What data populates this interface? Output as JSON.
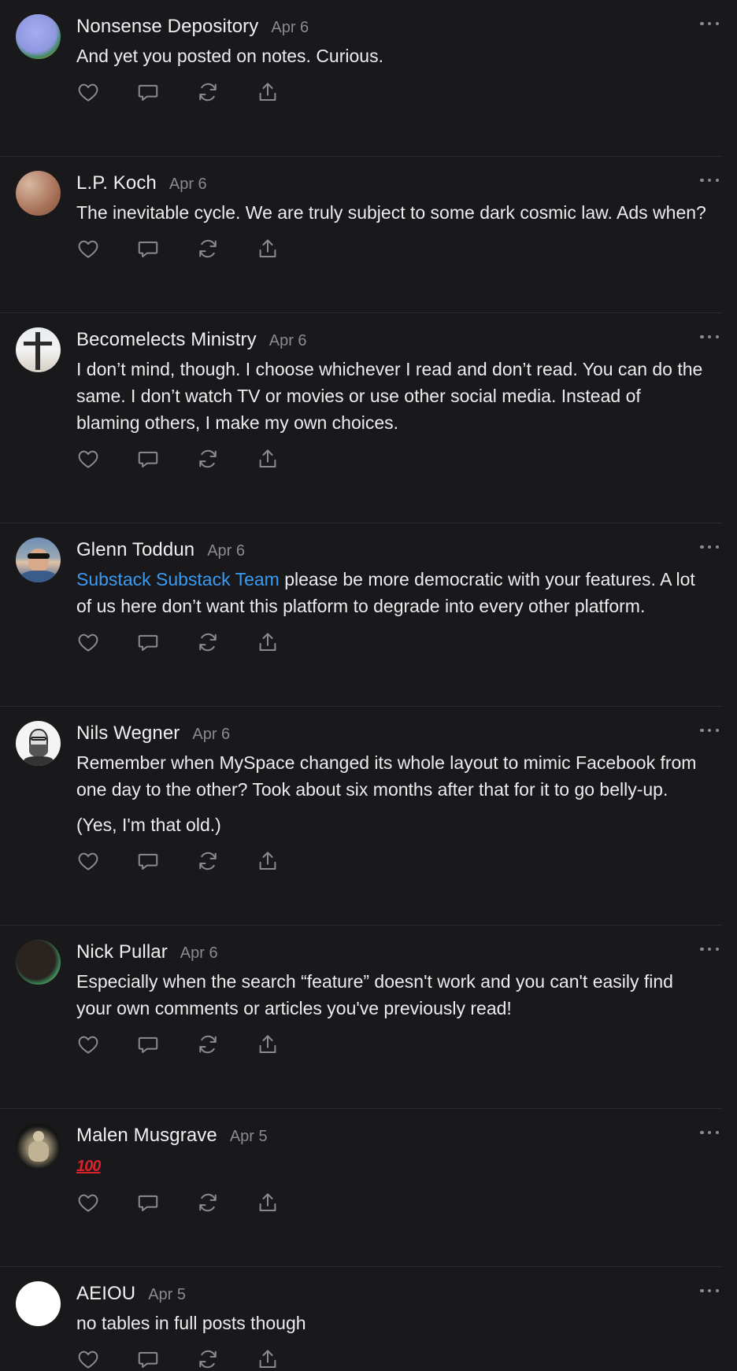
{
  "comments": [
    {
      "author": "Nonsense Depository",
      "date": "Apr 6",
      "avatar": "gradient-sphere-purple",
      "paragraphs": [
        "And yet you posted on notes. Curious."
      ]
    },
    {
      "author": "L.P. Koch",
      "date": "Apr 6",
      "avatar": "textured-brown",
      "paragraphs": [
        "The inevitable cycle. We are truly subject to some dark cosmic law. Ads when?"
      ]
    },
    {
      "author": "Becomelects Ministry",
      "date": "Apr 6",
      "avatar": "cross-photo",
      "paragraphs": [
        "I don’t mind, though. I choose whichever I read and don’t read. You can do the same. I don’t watch TV or movies or use other social media. Instead of blaming others, I make my own choices."
      ]
    },
    {
      "author": "Glenn Toddun",
      "date": "Apr 6",
      "avatar": "man-sunglasses-photo",
      "mention": "Substack Substack Team",
      "paragraphs": [
        " please be more democratic with your features. A lot of us here don’t want this platform to degrade into every other platform."
      ]
    },
    {
      "author": "Nils Wegner",
      "date": "Apr 6",
      "avatar": "bearded-man-drawing",
      "paragraphs": [
        "Remember when MySpace changed its whole layout to mimic Facebook from one day to the other? Took about six months after that for it to go belly-up.",
        "(Yes, I'm that old.)"
      ]
    },
    {
      "author": "Nick Pullar",
      "date": "Apr 6",
      "avatar": "gradient-sphere-dark",
      "paragraphs": [
        "Especially when the search “feature” doesn't work and you can't easily find your own comments or articles you've previously read!"
      ]
    },
    {
      "author": "Malen Musgrave",
      "date": "Apr 5",
      "avatar": "statue-photo",
      "emoji": "100",
      "paragraphs": []
    },
    {
      "author": "AEIOU",
      "date": "Apr 5",
      "avatar": "white-circle",
      "paragraphs": [
        "no tables in full posts though"
      ]
    }
  ],
  "actions": [
    "like",
    "reply",
    "restack",
    "share"
  ],
  "icons": {
    "like": "heart-icon",
    "reply": "speech-bubble-icon",
    "restack": "restack-icon",
    "share": "share-icon",
    "more": "more-dots-icon"
  },
  "colors": {
    "background": "#19191b",
    "text": "#ececee",
    "muted": "#8a8a90",
    "divider": "#2c2c30",
    "mention": "#3a9bf5"
  }
}
